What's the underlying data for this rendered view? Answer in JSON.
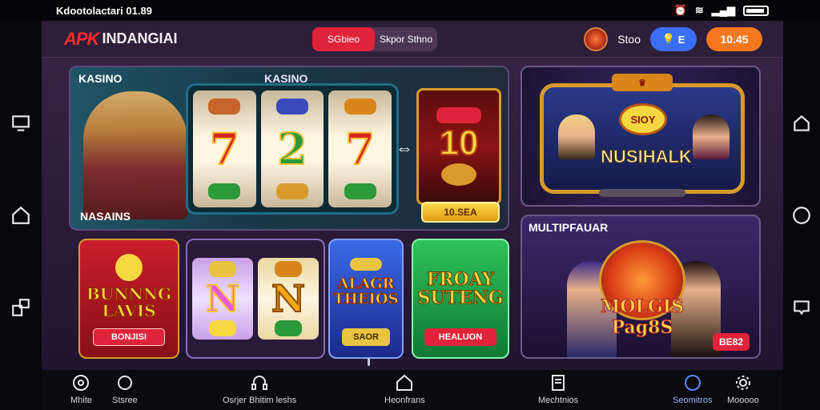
{
  "status_bar": {
    "time_text": "Kdootolactari 01.89"
  },
  "header": {
    "logo_badge": "APK",
    "logo_text": "INDANGIAI",
    "tabs": [
      {
        "label": "SGbieo",
        "active": true
      },
      {
        "label": "Skpor Sthno",
        "active": false
      }
    ],
    "balance_label": "Stoo",
    "blue_pill_label": "E",
    "orange_pill_label": "10.45"
  },
  "hero": {
    "title": "KASINO",
    "title_center": "KASINO",
    "subtitle": "NASAINS",
    "jackpot_value": "10",
    "jackpot_button": "10.SEA",
    "reel_symbols": [
      "7",
      "2",
      "7"
    ]
  },
  "promo": {
    "crown_label": "",
    "badge": "SIOY",
    "title": "NUSIHALK"
  },
  "tiles": {
    "bonus": {
      "title": "BUNNNG LAVIS",
      "button": "BONJISI"
    },
    "n_slot": {
      "symbols": [
        "N",
        "N"
      ]
    },
    "alarm": {
      "title": "ALAGR THEIOS",
      "button": "SAOR"
    },
    "friday": {
      "title": "FROAY SUTENG",
      "button": "HEALUON"
    }
  },
  "multi": {
    "title": "MULTIPFAUAR",
    "name": "MOLGIS Pag8S",
    "badge": "BE82"
  },
  "bottom_nav": [
    {
      "label": "Mhite",
      "active": false
    },
    {
      "label": "Stsree",
      "active": false
    },
    {
      "label": "Osrjer Bhitim leshs",
      "active": false
    },
    {
      "label": "Heonfrans",
      "active": false
    },
    {
      "label": "Mechtnios",
      "active": false
    },
    {
      "label": "Seomitros",
      "active": true
    },
    {
      "label": "Mooooo",
      "active": false
    }
  ],
  "colors": {
    "accent_red": "#e0233a",
    "accent_orange": "#f5781e",
    "accent_blue": "#3a6ef5",
    "gold": "#d89a2a"
  }
}
